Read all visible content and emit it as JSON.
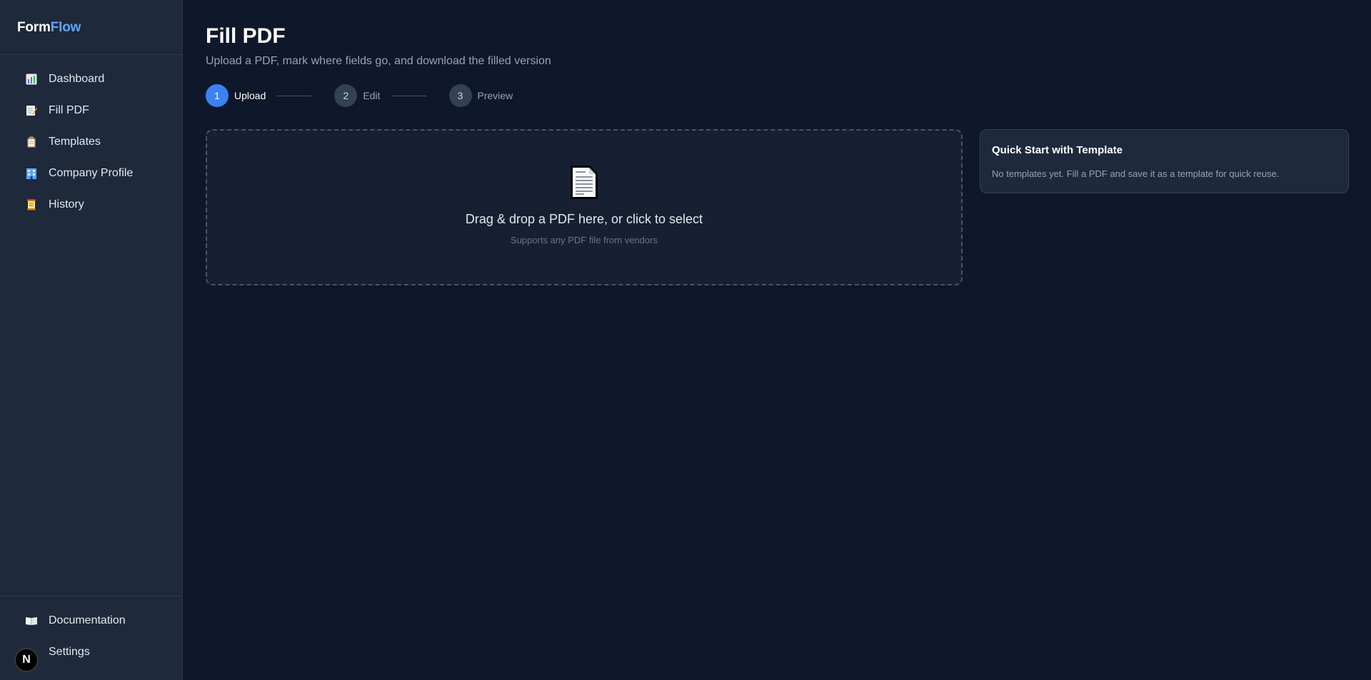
{
  "brand": {
    "part1": "Form",
    "part2": "Flow"
  },
  "sidebar": {
    "items": [
      {
        "label": "Dashboard",
        "icon": "bar-chart-icon"
      },
      {
        "label": "Fill PDF",
        "icon": "memo-icon"
      },
      {
        "label": "Templates",
        "icon": "clipboard-icon"
      },
      {
        "label": "Company Profile",
        "icon": "office-building-icon"
      },
      {
        "label": "History",
        "icon": "scroll-icon"
      }
    ],
    "footer": [
      {
        "label": "Documentation",
        "icon": "open-book-icon"
      },
      {
        "label": "Settings",
        "icon": "gear-icon"
      }
    ],
    "badge": "N"
  },
  "page": {
    "title": "Fill PDF",
    "subtitle": "Upload a PDF, mark where fields go, and download the filled version"
  },
  "stepper": {
    "steps": [
      {
        "number": "1",
        "label": "Upload",
        "active": true
      },
      {
        "number": "2",
        "label": "Edit",
        "active": false
      },
      {
        "number": "3",
        "label": "Preview",
        "active": false
      }
    ]
  },
  "dropzone": {
    "icon": "page-document-icon",
    "title": "Drag & drop a PDF here, or click to select",
    "subtitle": "Supports any PDF file from vendors"
  },
  "quickstart": {
    "title": "Quick Start with Template",
    "text": "No templates yet. Fill a PDF and save it as a template for quick reuse."
  },
  "colors": {
    "background": "#0f172a",
    "sidebar": "#1e293b",
    "accent": "#3b82f6",
    "brand_accent": "#60a5fa"
  }
}
